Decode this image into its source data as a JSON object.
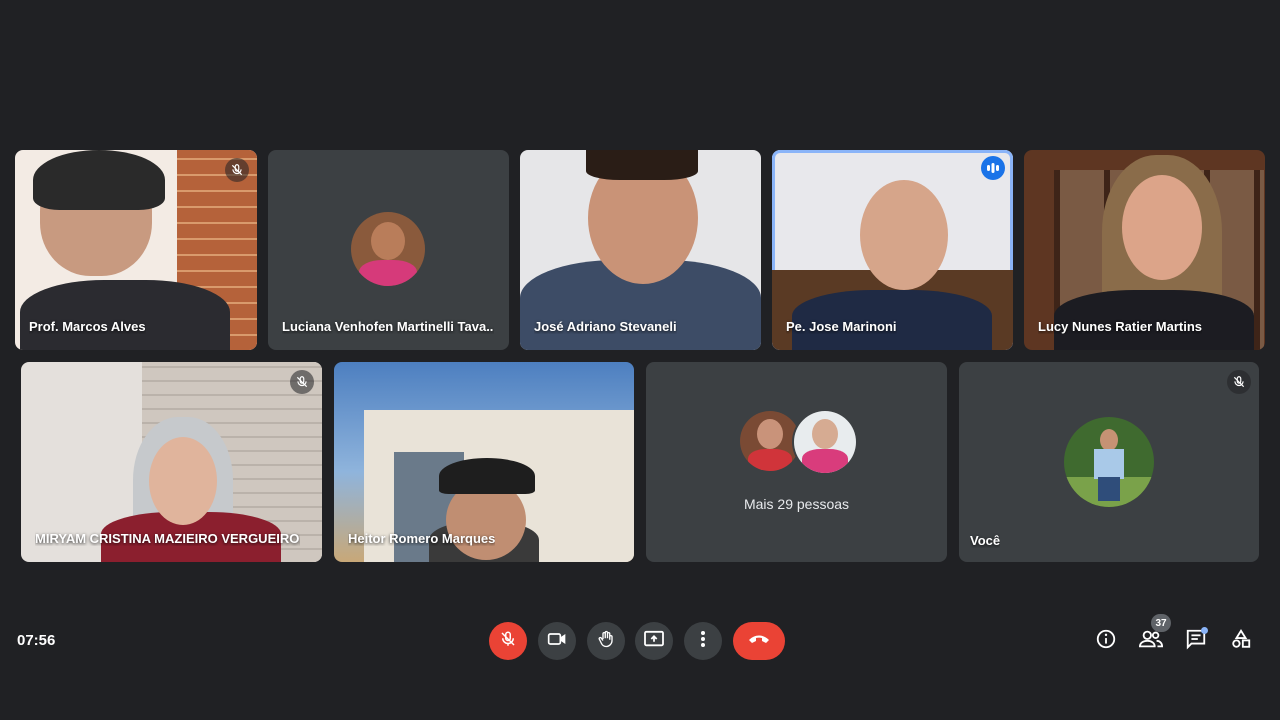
{
  "participants": {
    "marcos": {
      "name": "Prof. Marcos Alves"
    },
    "luciana": {
      "name": "Luciana Venhofen Martinelli Tava..."
    },
    "jose_adriano": {
      "name": "José Adriano Stevaneli"
    },
    "jose_marinoni": {
      "name": "Pe. Jose Marinoni"
    },
    "lucy": {
      "name": "Lucy Nunes Ratier Martins"
    },
    "miryam": {
      "name": "MIRYAM CRISTINA MAZIEIRO VERGUEIRO..."
    },
    "heitor": {
      "name": "Heitor Romero Marques"
    },
    "more": {
      "label": "Mais 29 pessoas"
    },
    "you": {
      "name": "Você"
    }
  },
  "bottom_bar": {
    "time": "07:56",
    "participant_count": "37",
    "icons": [
      "mic-off-icon",
      "camera-icon",
      "raise-hand-icon",
      "present-icon",
      "more-options-icon",
      "end-call-icon",
      "info-icon",
      "people-icon",
      "chat-icon",
      "activities-icon"
    ]
  },
  "colors": {
    "background": "#202124",
    "tile": "#3c4043",
    "accent": "#8ab4f8",
    "danger": "#ea4335",
    "speaking": "#1a73e8"
  }
}
